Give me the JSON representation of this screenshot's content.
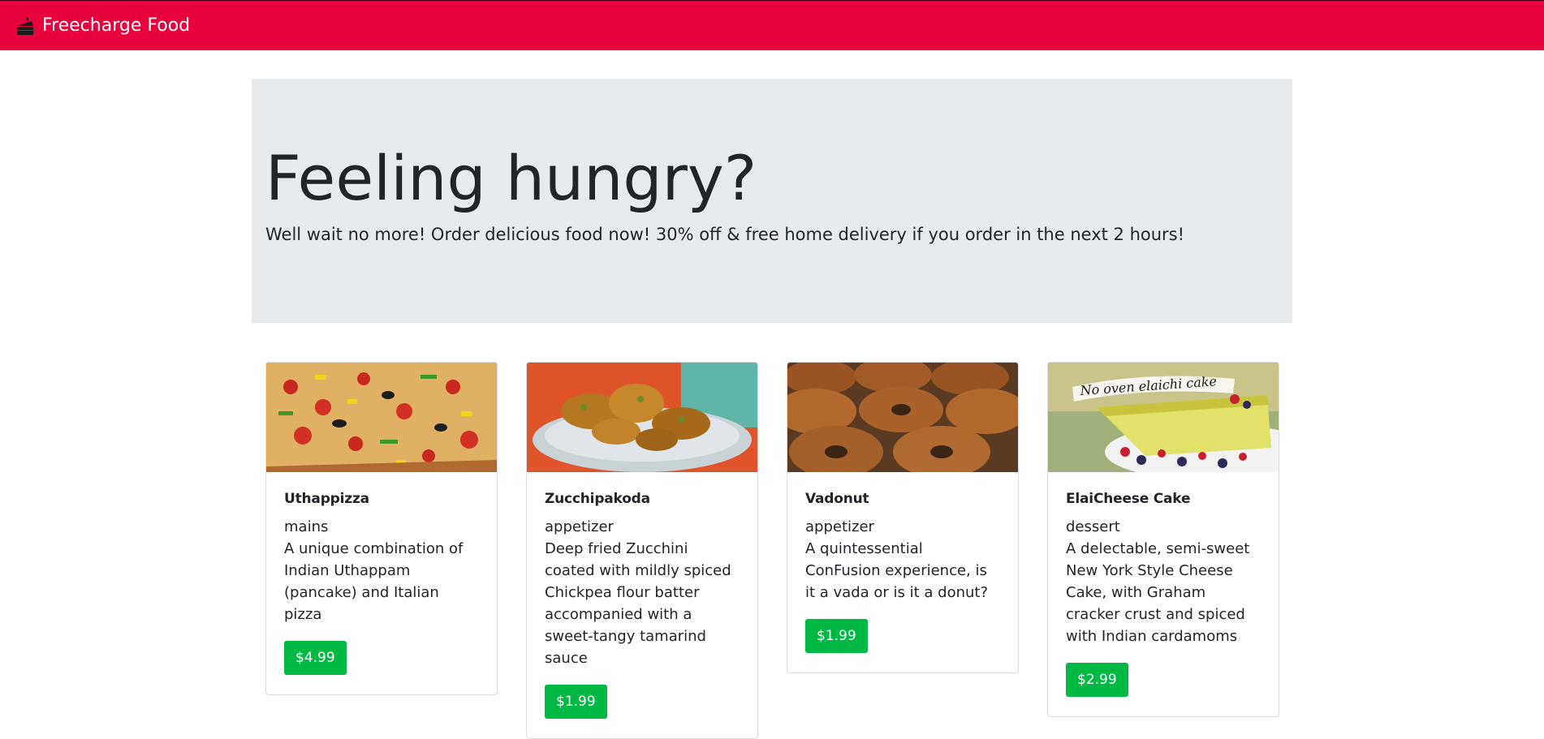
{
  "navbar": {
    "brand": "Freecharge Food",
    "brand_icon": "cake-slice-icon",
    "background": "#e8003d"
  },
  "hero": {
    "title": "Feeling hungry?",
    "lead": "Well wait no more! Order delicious food now! 30% off & free home delivery if you order in the next 2 hours!",
    "background": "#e8ebee"
  },
  "accent": "#00b944",
  "dishes": [
    {
      "name": "Uthappizza",
      "category": "mains",
      "description": "A unique combination of Indian Uthappam (pancake) and Italian pizza",
      "price": "$4.99",
      "image_subject": "pizza"
    },
    {
      "name": "Zucchipakoda",
      "category": "appetizer",
      "description": "Deep fried Zucchini coated with mildly spiced Chickpea flour batter accompanied with a sweet-tangy tamarind sauce",
      "price": "$1.99",
      "image_subject": "pakoda"
    },
    {
      "name": "Vadonut",
      "category": "appetizer",
      "description": "A quintessential ConFusion experience, is it a vada or is it a donut?",
      "price": "$1.99",
      "image_subject": "donuts"
    },
    {
      "name": "ElaiCheese Cake",
      "category": "dessert",
      "description": "A delectable, semi-sweet New York Style Cheese Cake, with Graham cracker crust and spiced with Indian cardamoms",
      "price": "$2.99",
      "image_subject": "cheesecake",
      "image_caption": "No oven elaichi cake"
    }
  ]
}
